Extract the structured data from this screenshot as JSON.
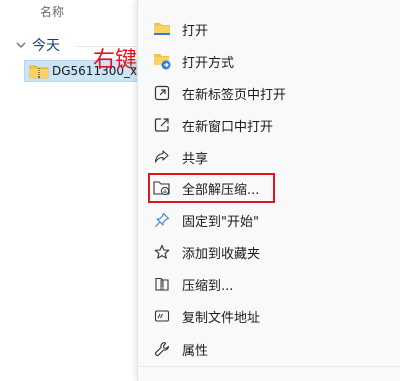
{
  "explorer": {
    "column_header": "名称",
    "group_label": "今天",
    "file_name": "DG5611300_x6"
  },
  "annotation_text": "右键",
  "colors": {
    "accent": "#0067c0",
    "annotation_red": "#e0141e",
    "selection": "#cce4f7"
  },
  "menu": {
    "items": [
      {
        "label": "打开",
        "icon": "folder-icon"
      },
      {
        "label": "打开方式",
        "icon": "open-with-icon"
      },
      {
        "label": "在新标签页中打开",
        "icon": "new-tab-icon"
      },
      {
        "label": "在新窗口中打开",
        "icon": "new-window-icon"
      },
      {
        "label": "共享",
        "icon": "share-icon"
      },
      {
        "label": "全部解压缩...",
        "icon": "extract-all-icon"
      },
      {
        "label": "固定到\"开始\"",
        "icon": "pin-icon"
      },
      {
        "label": "添加到收藏夹",
        "icon": "star-icon"
      },
      {
        "label": "压缩到...",
        "icon": "compress-icon"
      },
      {
        "label": "复制文件地址",
        "icon": "copy-path-icon"
      },
      {
        "label": "属性",
        "icon": "properties-icon"
      }
    ]
  }
}
